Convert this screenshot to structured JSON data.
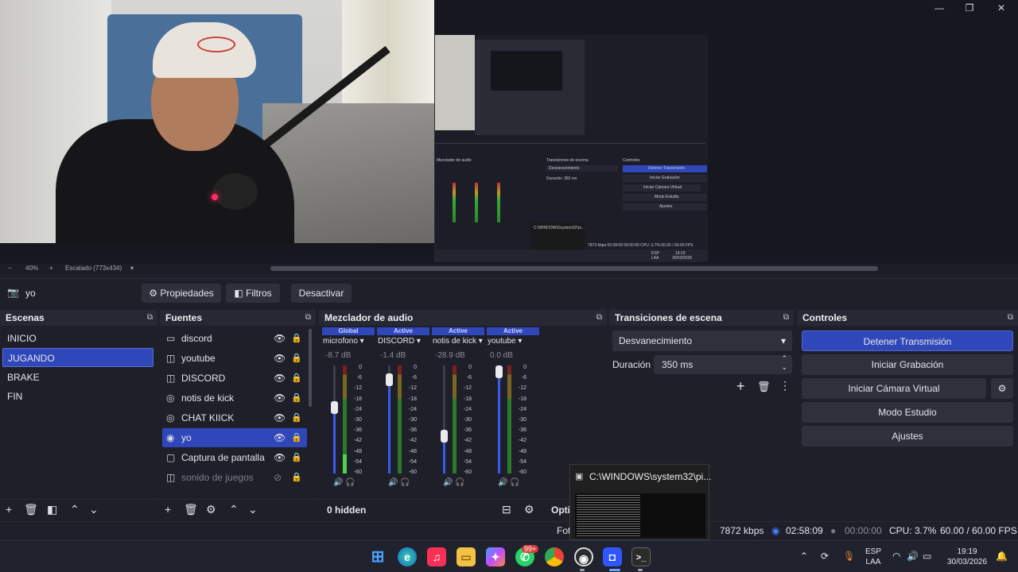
{
  "window": {
    "minimize": "—",
    "maximize": "❐",
    "close": "✕"
  },
  "preview": {
    "zoom_minus": "−",
    "zoom_level": "40%",
    "zoom_plus": "+",
    "scaling": "Escalado (773x434)",
    "nested": {
      "mixer_title": "Mezclador de audio",
      "transitions_title": "Transiciones de escena",
      "controls_title": "Controles",
      "fade": "Desvanecimiento",
      "duration_label": "Duración",
      "duration_value": "350 ms",
      "ctl": [
        "Detener Transmisión",
        "Iniciar Grabación",
        "Iniciar Cámara Virtual",
        "Modo Estudio",
        "Ajustes"
      ],
      "console": "C:\\WINDOWS\\system32\\pi...",
      "status": "7872 kbps   02:58:09   00:00:00   CPU: 3.7%   60.00 / 60.00 FPS",
      "clock_time": "19:19",
      "clock_date": "30/03/2026",
      "lang1": "ESP",
      "lang2": "LAA"
    }
  },
  "source_toolbar": {
    "selected_source": "yo",
    "camera_icon": "camera-icon",
    "properties": "Propiedades",
    "filters": "Filtros",
    "deactivate": "Desactivar"
  },
  "scenes": {
    "title": "Escenas",
    "items": [
      "INICIO",
      "JUGANDO",
      "BRAKE",
      "FIN"
    ],
    "selected": "JUGANDO"
  },
  "sources": {
    "title": "Fuentes",
    "items": [
      {
        "label": "discord",
        "icon": "window-icon",
        "visible": true
      },
      {
        "label": "youtube",
        "icon": "audio-output-icon",
        "visible": true
      },
      {
        "label": "DISCORD",
        "icon": "audio-output-icon",
        "visible": true
      },
      {
        "label": "notis de kick",
        "icon": "browser-icon",
        "visible": true
      },
      {
        "label": "CHAT KIICK",
        "icon": "browser-icon",
        "visible": true
      },
      {
        "label": "yo",
        "icon": "camera-icon",
        "visible": true,
        "selected": true
      },
      {
        "label": "Captura de pantalla",
        "icon": "monitor-icon",
        "visible": true
      },
      {
        "label": "sonido de juegos",
        "icon": "audio-output-icon",
        "visible": false
      }
    ]
  },
  "mixer": {
    "title": "Mezclador de audio",
    "channels": [
      {
        "tag": "Global",
        "name": "microfono",
        "db": "-8.7 dB",
        "volume": 0.64,
        "level": 0.18
      },
      {
        "tag": "Active",
        "name": "DISCORD",
        "db": "-1.4 dB",
        "volume": 0.92,
        "level": 0
      },
      {
        "tag": "Active",
        "name": "notis de kick",
        "db": "-28.9 dB",
        "volume": 0.36,
        "level": 0
      },
      {
        "tag": "Active",
        "name": "youtube",
        "db": "0.0 dB",
        "volume": 1.0,
        "level": 0
      }
    ],
    "ticks": [
      "0",
      "-6",
      "-12",
      "-18",
      "-24",
      "-30",
      "-36",
      "-42",
      "-48",
      "-54",
      "-60"
    ],
    "hidden_count": "0 hidden",
    "options_label": "Opti"
  },
  "transitions": {
    "title": "Transiciones de escena",
    "selected": "Desvanecimiento",
    "duration_label": "Duración",
    "duration_value": "350 ms"
  },
  "controls": {
    "title": "Controles",
    "stop_stream": "Detener Transmisión",
    "start_recording": "Iniciar Grabación",
    "start_virtual_cam": "Iniciar Cámara Virtual",
    "studio_mode": "Modo Estudio",
    "settings": "Ajustes"
  },
  "status": {
    "partial_left": "Fot",
    "bitrate": "7872 kbps",
    "stream_time": "02:58:09",
    "record_time": "00:00:00",
    "cpu": "CPU: 3.7%",
    "fps": "60.00 / 60.00 FPS"
  },
  "console_popup": {
    "title": "C:\\WINDOWS\\system32\\pi..."
  },
  "taskbar": {
    "badge": "99+",
    "tray_lang1": "ESP",
    "tray_lang2": "LAA",
    "time": "19:19",
    "date": "30/03/2026"
  },
  "colors": {
    "accent": "#2f47b9",
    "panel": "#1e1f29",
    "header": "#272834"
  }
}
